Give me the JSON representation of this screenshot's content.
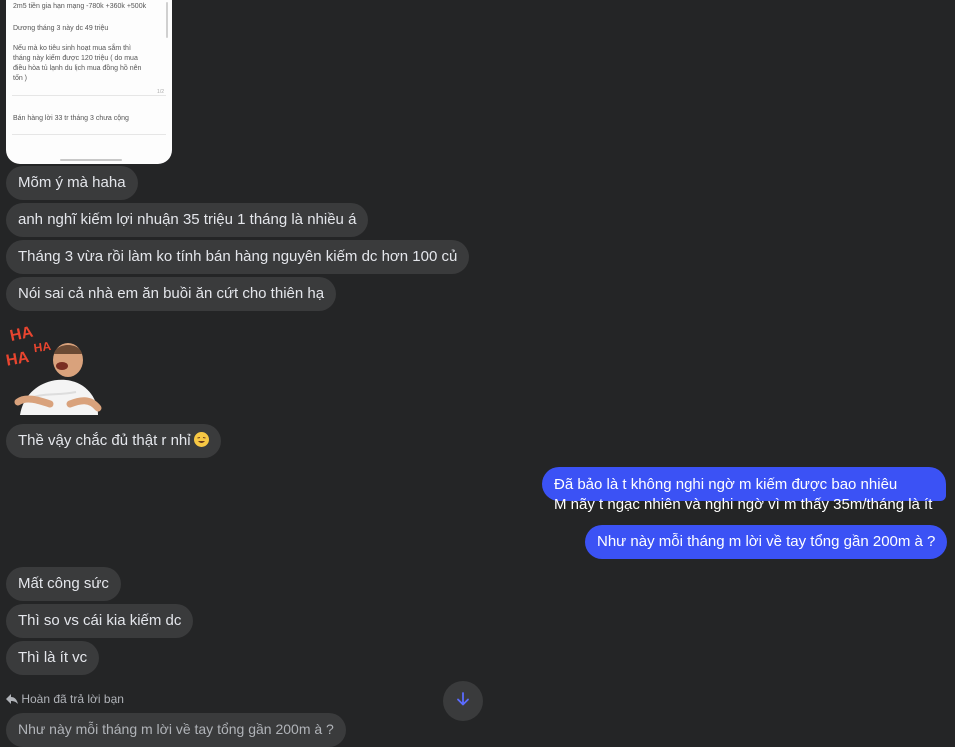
{
  "screenshot_card": {
    "lines": [
      "2m5 tiền gia hạn mạng -780k +360k +500k",
      "Dương tháng 3 này   dc 49 triệu",
      "Nếu mà ko tiêu sinh hoạt mua sắm thì",
      "tháng này kiếm được 120 triệu ( do mua",
      "điều hòa tủ lạnh du lịch mua đồng hồ nên",
      "tốn )",
      "Bán hàng lời 33 tr tháng 3 chưa cộng"
    ],
    "page_indicator": "1/2"
  },
  "messages": {
    "m1": "Mõm ý mà haha",
    "m2": "anh nghĩ kiếm lợi nhuận 35 triệu 1 tháng là nhiều á",
    "m3": "Tháng 3 vừa rồi làm ko tính bán hàng nguyên kiếm dc hơn 100 củ",
    "m4": "Nói sai cả nhà em ăn buồi ăn cứt cho thiên hạ",
    "m5": "Thề vậy chắc đủ thật r nhỉ",
    "me1_line1": "Đã bảo là t không nghi ngờ m kiếm được bao nhiêu",
    "me1_line2": "M nãy t ngạc nhiên và nghi ngờ vì m thấy 35m/tháng là ít",
    "me2": "Như này mỗi tháng m lời về tay tổng gần 200m à ?",
    "m6": "Mất công sức",
    "m7": "Thì so vs cái kia kiếm dc",
    "m8": "Thì là ít vc"
  },
  "sticker": {
    "text": "HAHAHA"
  },
  "reply": {
    "label": "Hoàn đã trả lời bạn",
    "quote": "Như này mỗi tháng m lời về tay tổng gần 200m à ?"
  },
  "colors": {
    "background": "#242526",
    "incoming_bubble": "#3a3b3c",
    "outgoing_bubble": "#3b52f5"
  }
}
